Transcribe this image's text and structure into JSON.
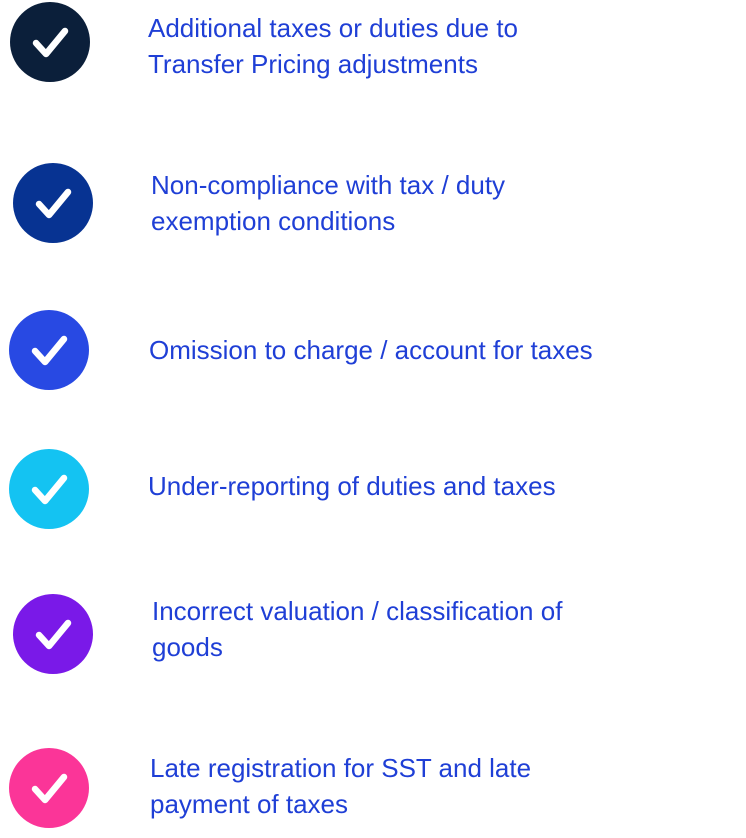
{
  "items": [
    {
      "lines": [
        "Additional taxes or duties due to",
        "Transfer Pricing adjustments"
      ],
      "badge_color": "#0b1f3a",
      "text_color": "#1f3fd6",
      "icon": "check-icon"
    },
    {
      "lines": [
        "Non-compliance with tax / duty",
        "exemption conditions"
      ],
      "badge_color": "#073392",
      "text_color": "#1f3fd6",
      "icon": "check-icon"
    },
    {
      "lines": [
        "Omission to charge / account for taxes"
      ],
      "badge_color": "#2849e3",
      "text_color": "#1f3fd6",
      "icon": "check-icon"
    },
    {
      "lines": [
        "Under-reporting of duties and taxes"
      ],
      "badge_color": "#14c3f2",
      "text_color": "#1f3fd6",
      "icon": "check-icon"
    },
    {
      "lines": [
        "Incorrect valuation / classification of",
        "goods"
      ],
      "badge_color": "#7a19e8",
      "text_color": "#1f3fd6",
      "icon": "check-icon"
    },
    {
      "lines": [
        "Late registration for SST and late",
        "payment of taxes"
      ],
      "badge_color": "#fb3598",
      "text_color": "#1f3fd6",
      "icon": "check-icon"
    }
  ]
}
